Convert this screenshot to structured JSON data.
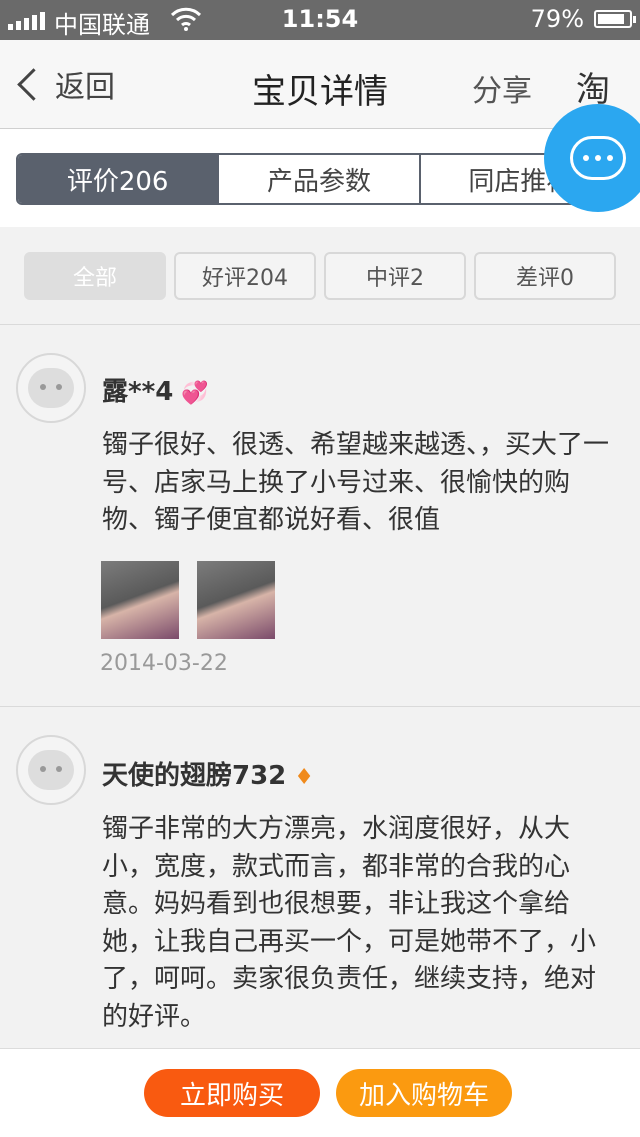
{
  "status_bar": {
    "carrier": "中国联通",
    "time": "11:54",
    "battery": "79%"
  },
  "nav": {
    "back_label": "返回",
    "title": "宝贝详情",
    "share_label": "分享",
    "taobao_label": "淘"
  },
  "tabs": [
    {
      "label": "评价206",
      "active": true
    },
    {
      "label": "产品参数",
      "active": false
    },
    {
      "label": "同店推荐",
      "active": false
    }
  ],
  "filters": [
    {
      "label": "全部",
      "active": true
    },
    {
      "label": "好评204",
      "active": false
    },
    {
      "label": "中评2",
      "active": false
    },
    {
      "label": "差评0",
      "active": false
    }
  ],
  "reviews": [
    {
      "username": "露**4",
      "rank_icon": "heart-icon",
      "text": "镯子很好、很透、希望越来越透、，买大了一号、店家马上换了小号过来、很愉快的购物、镯子便宜都说好看、很值",
      "date": "2014-03-22",
      "image_count": 2
    },
    {
      "username": "天使的翅膀732",
      "rank_icon": "diamond-icon",
      "text": "镯子非常的大方漂亮，水润度很好，从大小，宽度，款式而言，都非常的合我的心意。妈妈看到也很想要，非让我这个拿给她，让我自己再买一个，可是她带不了，小了，呵呵。卖家很负责任，继续支持，绝对的好评。"
    }
  ],
  "bottom": {
    "buy_label": "立即购买",
    "cart_label": "加入购物车"
  },
  "colors": {
    "tab_active": "#5a616d",
    "chat_fab": "#2ba7f0",
    "buy": "#f95a10",
    "cart": "#fb9a10"
  }
}
